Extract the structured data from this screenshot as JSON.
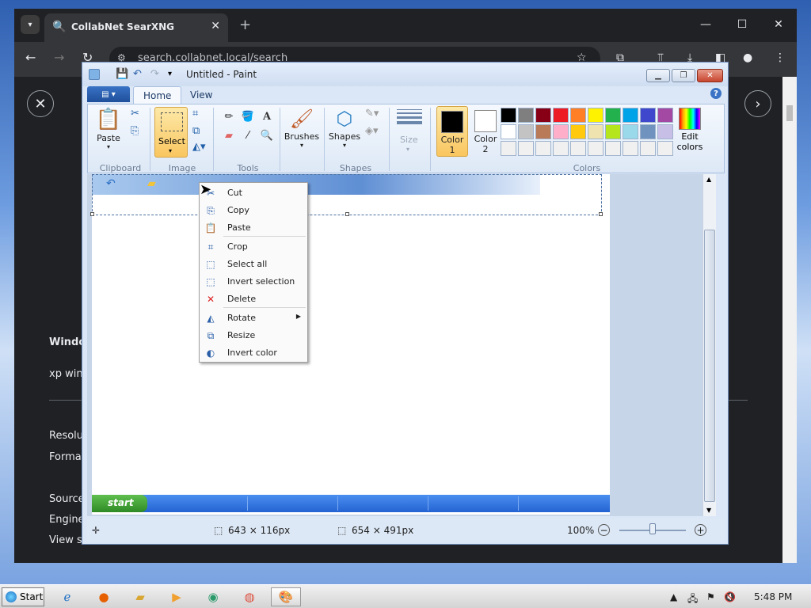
{
  "browser": {
    "tab_title": "CollabNet SearXNG",
    "url": "search.collabnet.local/search",
    "page_lines": {
      "heading": "Windo",
      "sub": "xp wind",
      "resolution": "Resolu",
      "format": "Format",
      "source": "Source",
      "engine": "Engine",
      "view": "View s"
    }
  },
  "paint": {
    "title": "Untitled - Paint",
    "tabs": {
      "home": "Home",
      "view": "View"
    },
    "groups": {
      "clipboard": "Clipboard",
      "image": "Image",
      "tools": "Tools",
      "shapes": "Shapes",
      "colors": "Colors"
    },
    "buttons": {
      "paste": "Paste",
      "select": "Select",
      "brushes": "Brushes",
      "shapes": "Shapes",
      "size": "Size",
      "color1_a": "Color",
      "color1_b": "1",
      "color2_a": "Color",
      "color2_b": "2",
      "edit_colors_a": "Edit",
      "edit_colors_b": "colors"
    },
    "color1": "#000000",
    "color2": "#ffffff",
    "palette": [
      "#000000",
      "#7f7f7f",
      "#880015",
      "#ed1c24",
      "#ff7f27",
      "#fff200",
      "#22b14c",
      "#00a2e8",
      "#3f48cc",
      "#a349a4",
      "#ffffff",
      "#c3c3c3",
      "#b97a57",
      "#ffaec9",
      "#ffc90e",
      "#efe4b0",
      "#b5e61d",
      "#99d9ea",
      "#7092be",
      "#c8bfe7",
      "#f0f0f0",
      "#f0f0f0",
      "#f0f0f0",
      "#f0f0f0",
      "#f0f0f0",
      "#f0f0f0",
      "#f0f0f0",
      "#f0f0f0",
      "#f0f0f0",
      "#f0f0f0"
    ],
    "image_start_label": "start",
    "status": {
      "selection_size": "643 × 116px",
      "image_size": "654 × 491px",
      "zoom": "100%"
    }
  },
  "context_menu": {
    "items": [
      {
        "label": "Cut",
        "icon": "scissors-icon"
      },
      {
        "label": "Copy",
        "icon": "copy-icon"
      },
      {
        "label": "Paste",
        "icon": "paste-icon"
      },
      {
        "label": "Crop",
        "icon": "crop-icon"
      },
      {
        "label": "Select all",
        "icon": "select-all-icon"
      },
      {
        "label": "Invert selection",
        "icon": "invert-selection-icon"
      },
      {
        "label": "Delete",
        "icon": "delete-icon"
      },
      {
        "label": "Rotate",
        "icon": "rotate-icon"
      },
      {
        "label": "Resize",
        "icon": "resize-icon"
      },
      {
        "label": "Invert color",
        "icon": "invert-color-icon"
      }
    ]
  },
  "taskbar": {
    "start": "Start",
    "clock": "5:48 PM"
  }
}
